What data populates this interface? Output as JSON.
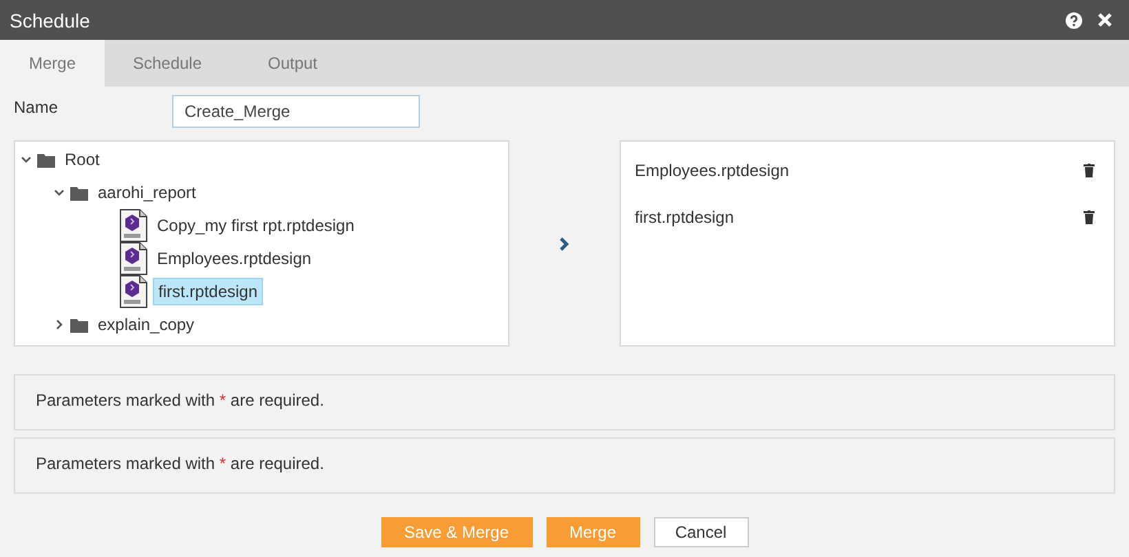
{
  "window": {
    "title": "Schedule"
  },
  "tabs": [
    {
      "label": "Merge",
      "selected": true
    },
    {
      "label": "Schedule",
      "selected": false
    },
    {
      "label": "Output",
      "selected": false
    }
  ],
  "name_field": {
    "label": "Name",
    "value": "Create_Merge"
  },
  "tree": [
    {
      "kind": "folder",
      "label": "Root",
      "expanded": true,
      "selected": false,
      "children": [
        {
          "kind": "folder",
          "label": "aarohi_report",
          "expanded": true,
          "selected": false,
          "children": [
            {
              "kind": "file",
              "label": "Copy_my first rpt.rptdesign",
              "selected": false
            },
            {
              "kind": "file",
              "label": "Employees.rptdesign",
              "selected": false
            },
            {
              "kind": "file",
              "label": "first.rptdesign",
              "selected": true
            }
          ]
        },
        {
          "kind": "folder",
          "label": "explain_copy",
          "expanded": false,
          "selected": false
        }
      ]
    }
  ],
  "selected_files": [
    {
      "label": "Employees.rptdesign"
    },
    {
      "label": "first.rptdesign"
    }
  ],
  "notes": [
    {
      "before": "Parameters marked with",
      "marker": "*",
      "after": "are required."
    },
    {
      "before": "Parameters marked with",
      "marker": "*",
      "after": "are required."
    }
  ],
  "buttons": [
    {
      "label": "Save & Merge",
      "kind": "primary"
    },
    {
      "label": "Merge",
      "kind": "primary"
    },
    {
      "label": "Cancel",
      "kind": "default"
    }
  ]
}
